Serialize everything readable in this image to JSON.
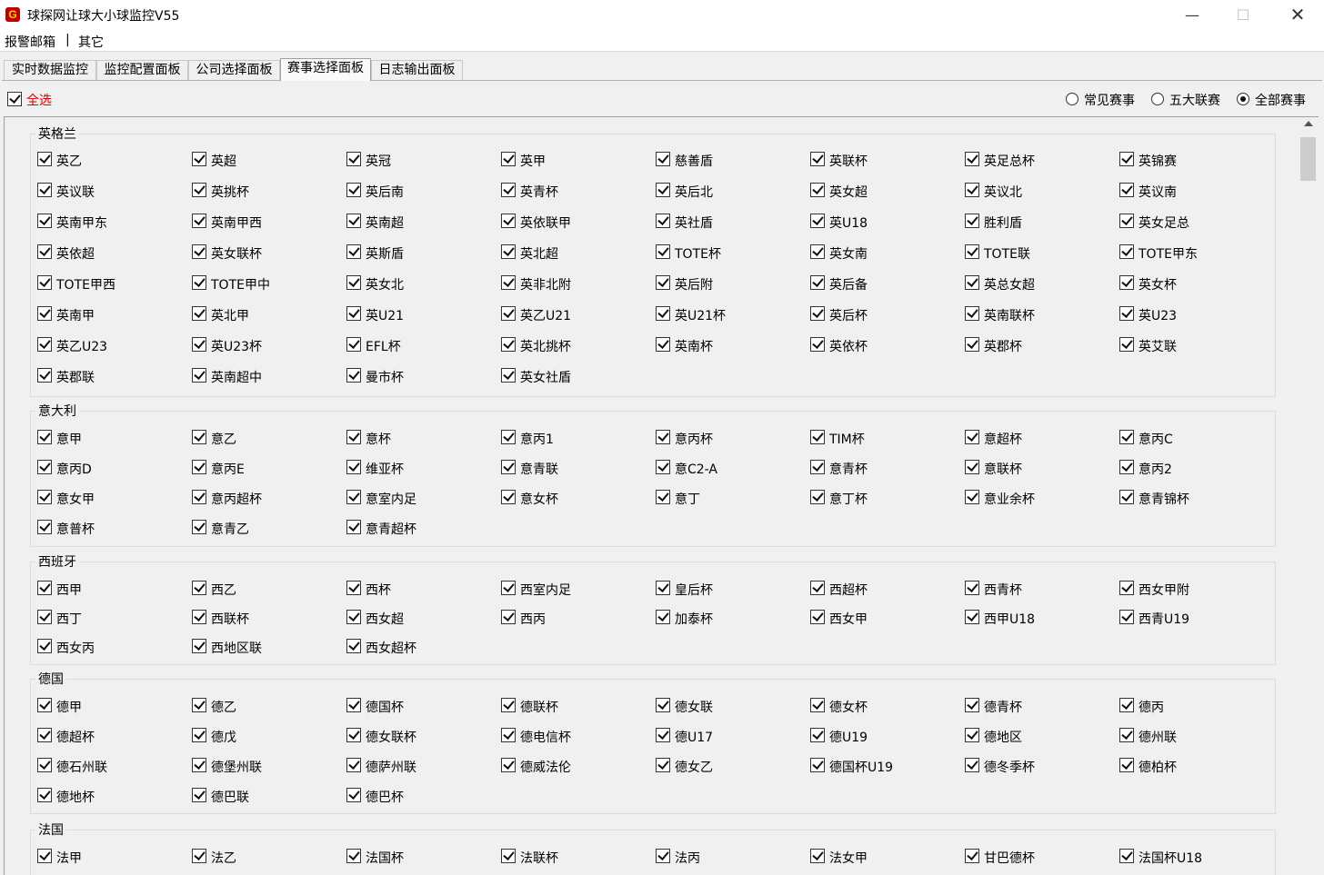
{
  "window": {
    "title": "球探网让球大小球监控V55",
    "app_icon_glyph": "G",
    "minimize_glyph": "—",
    "maximize_glyph": "☐",
    "close_glyph": "✕"
  },
  "menu": {
    "items": [
      "报警邮箱",
      "其它"
    ],
    "separator": "|"
  },
  "tabs": [
    {
      "label": "实时数据监控",
      "active": false
    },
    {
      "label": "监控配置面板",
      "active": false
    },
    {
      "label": "公司选择面板",
      "active": false
    },
    {
      "label": "赛事选择面板",
      "active": true
    },
    {
      "label": "日志输出面板",
      "active": false
    }
  ],
  "select_all": {
    "label": "全选",
    "checked": true,
    "color": "#e00000"
  },
  "filter": {
    "options": [
      "常见赛事",
      "五大联赛",
      "全部赛事"
    ],
    "selected": "全部赛事"
  },
  "groups": [
    {
      "title": "英格兰",
      "items": [
        "英乙",
        "英超",
        "英冠",
        "英甲",
        "慈善盾",
        "英联杯",
        "英足总杯",
        "英锦赛",
        "英议联",
        "英挑杯",
        "英后南",
        "英青杯",
        "英后北",
        "英女超",
        "英议北",
        "英议南",
        "英南甲东",
        "英南甲西",
        "英南超",
        "英依联甲",
        "英社盾",
        "英U18",
        "胜利盾",
        "英女足总",
        "英依超",
        "英女联杯",
        "英斯盾",
        "英北超",
        "TOTE杯",
        "英女南",
        "TOTE联",
        "TOTE甲东",
        "TOTE甲西",
        "TOTE甲中",
        "英女北",
        "英非北附",
        "英后附",
        "英后备",
        "英总女超",
        "英女杯",
        "英南甲",
        "英北甲",
        "英U21",
        "英乙U21",
        "英U21杯",
        "英后杯",
        "英南联杯",
        "英U23",
        "英乙U23",
        "英U23杯",
        "EFL杯",
        "英北挑杯",
        "英南杯",
        "英依杯",
        "英郡杯",
        "英艾联",
        "英郡联",
        "英南超中",
        "曼市杯",
        "英女社盾"
      ]
    },
    {
      "title": "意大利",
      "items": [
        "意甲",
        "意乙",
        "意杯",
        "意丙1",
        "意丙杯",
        "TIM杯",
        "意超杯",
        "意丙C",
        "意丙D",
        "意丙E",
        "维亚杯",
        "意青联",
        "意C2-A",
        "意青杯",
        "意联杯",
        "意丙2",
        "意女甲",
        "意丙超杯",
        "意室内足",
        "意女杯",
        "意丁",
        "意丁杯",
        "意业余杯",
        "意青锦杯",
        "意普杯",
        "意青乙",
        "意青超杯"
      ]
    },
    {
      "title": "西班牙",
      "items": [
        "西甲",
        "西乙",
        "西杯",
        "西室内足",
        "皇后杯",
        "西超杯",
        "西青杯",
        "西女甲附",
        "西丁",
        "西联杯",
        "西女超",
        "西丙",
        "加泰杯",
        "西女甲",
        "西甲U18",
        "西青U19",
        "西女丙",
        "西地区联",
        "西女超杯"
      ]
    },
    {
      "title": "德国",
      "items": [
        "德甲",
        "德乙",
        "德国杯",
        "德联杯",
        "德女联",
        "德女杯",
        "德青杯",
        "德丙",
        "德超杯",
        "德戊",
        "德女联杯",
        "德电信杯",
        "德U17",
        "德U19",
        "德地区",
        "德州联",
        "德石州联",
        "德堡州联",
        "德萨州联",
        "德威法伦",
        "德女乙",
        "德国杯U19",
        "德冬季杯",
        "德柏杯",
        "德地杯",
        "德巴联",
        "德巴杯"
      ]
    },
    {
      "title": "法国",
      "items": [
        "法甲",
        "法乙",
        "法国杯",
        "法联杯",
        "法丙",
        "法女甲",
        "甘巴德杯",
        "法国杯U18"
      ]
    }
  ]
}
